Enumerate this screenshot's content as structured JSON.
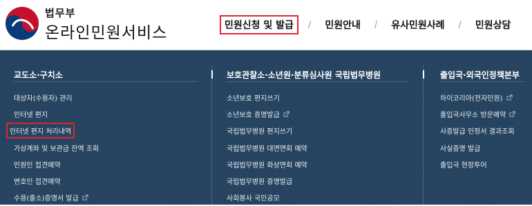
{
  "brand": {
    "top": "법무부",
    "main": "온라인민원서비스"
  },
  "nav": {
    "items": [
      {
        "label": "민원신청 및 발급",
        "active": true
      },
      {
        "label": "민원안내",
        "active": false
      },
      {
        "label": "유사민원사례",
        "active": false
      },
      {
        "label": "민원상담",
        "active": false
      }
    ],
    "separator": "/"
  },
  "menu": {
    "columns": [
      {
        "title": "교도소·구치소",
        "items": [
          {
            "label": "대상자(수용자) 관리",
            "external": false,
            "highlighted": false
          },
          {
            "label": "인터넷 편지",
            "external": false,
            "highlighted": false
          },
          {
            "label": "인터넷 편지 처리내역",
            "external": false,
            "highlighted": true
          },
          {
            "label": "가상계좌 및 보관금 잔액 조회",
            "external": false,
            "highlighted": false
          },
          {
            "label": "민원인 접견예약",
            "external": false,
            "highlighted": false
          },
          {
            "label": "변호인 접견예약",
            "external": false,
            "highlighted": false
          },
          {
            "label": "수용(출소)증명서 발급",
            "external": true,
            "highlighted": false
          }
        ]
      },
      {
        "title": "보호관찰소·소년원·분류심사원 국립법무병원",
        "items": [
          {
            "label": "소년보호 편지쓰기",
            "external": false,
            "highlighted": false
          },
          {
            "label": "소년보호 증명발급",
            "external": true,
            "highlighted": false
          },
          {
            "label": "국립법무병원 편지쓰기",
            "external": false,
            "highlighted": false
          },
          {
            "label": "국립법무병원 대면면회 예약",
            "external": false,
            "highlighted": false
          },
          {
            "label": "국립법무병원 화상면회 예약",
            "external": false,
            "highlighted": false
          },
          {
            "label": "국립법무병원 증명발급",
            "external": false,
            "highlighted": false
          },
          {
            "label": "사회봉사 국민공모",
            "external": false,
            "highlighted": false
          }
        ]
      },
      {
        "title": "출입국·외국인정책본부",
        "items": [
          {
            "label": "하이코리아(전자민원)",
            "external": true,
            "highlighted": false
          },
          {
            "label": "출입국사무소 방문예약",
            "external": true,
            "highlighted": false
          },
          {
            "label": "사증발급 인정서 결과조회",
            "external": false,
            "highlighted": false
          },
          {
            "label": "사실증명 발급",
            "external": false,
            "highlighted": false
          },
          {
            "label": "출입국 현장투어",
            "external": false,
            "highlighted": false
          }
        ]
      }
    ]
  },
  "colors": {
    "menu_bg": "#24425f",
    "highlight": "#e1252e",
    "logo_red": "#c8102e",
    "logo_blue": "#0a3a7a"
  }
}
